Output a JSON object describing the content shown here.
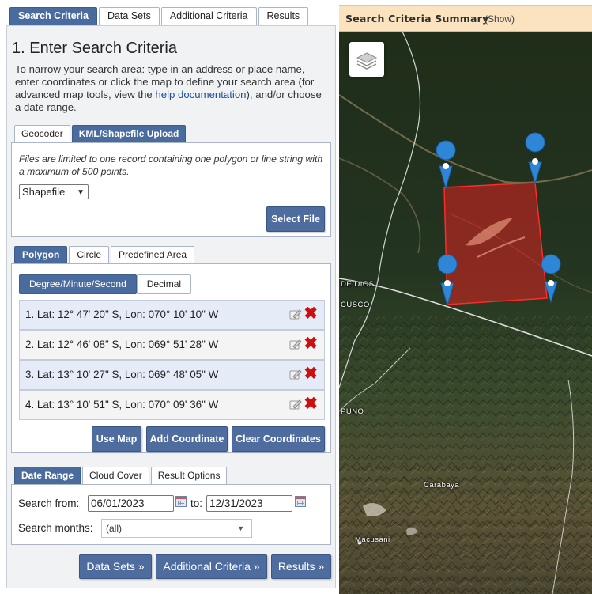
{
  "main_tabs": [
    {
      "label": "Search Criteria",
      "active": true
    },
    {
      "label": "Data Sets",
      "active": false
    },
    {
      "label": "Additional Criteria",
      "active": false
    },
    {
      "label": "Results",
      "active": false
    }
  ],
  "search": {
    "title": "1. Enter Search Criteria",
    "intro_before_link": "To narrow your search area: type in an address or place name, enter coordinates or click the map to define your search area (for advanced map tools, view the ",
    "help_link": "help documentation",
    "intro_after_link": "), and/or choose a date range."
  },
  "upload": {
    "tabs": [
      {
        "label": "Geocoder",
        "active": false
      },
      {
        "label": "KML/Shapefile Upload",
        "active": true
      }
    ],
    "note": "Files are limited to one record containing one polygon or line string with a maximum of 500 points.",
    "file_type": "Shapefile",
    "select_file_label": "Select File"
  },
  "area": {
    "tabs": [
      {
        "label": "Polygon",
        "active": true
      },
      {
        "label": "Circle",
        "active": false
      },
      {
        "label": "Predefined Area",
        "active": false
      }
    ],
    "format_tabs": [
      {
        "label": "Degree/Minute/Second",
        "active": true
      },
      {
        "label": "Decimal",
        "active": false
      }
    ],
    "coordinates": [
      "1.  Lat: 12° 47' 20\" S, Lon: 070° 10' 10\" W",
      "2.  Lat: 12° 46' 08\" S, Lon: 069° 51' 28\" W",
      "3.  Lat: 13° 10' 27\" S, Lon: 069° 48' 05\" W",
      "4.  Lat: 13° 10' 51\" S, Lon: 070° 09' 36\" W"
    ],
    "use_map_label": "Use Map",
    "add_coordinate_label": "Add Coordinate",
    "clear_coordinates_label": "Clear Coordinates"
  },
  "date": {
    "tabs": [
      {
        "label": "Date Range",
        "active": true
      },
      {
        "label": "Cloud Cover",
        "active": false
      },
      {
        "label": "Result Options",
        "active": false
      }
    ],
    "search_from_label": "Search from:",
    "from_value": "06/01/2023",
    "to_label": "to:",
    "to_value": "12/31/2023",
    "months_label": "Search months:",
    "months_value": "(all)"
  },
  "nav": {
    "datasets_label": "Data Sets »",
    "additional_label": "Additional Criteria »",
    "results_label": "Results »"
  },
  "summary": {
    "title": "Search Criteria Summary",
    "show_label": "(Show)"
  },
  "map": {
    "labels": {
      "de_dios": "DE DIOS",
      "cusco": "CUSCO",
      "puno": "PUNO",
      "carabaya": "Carabaya",
      "macusani": "Macusani"
    },
    "polygon_color": "#e02020",
    "marker_color": "#2f86d6"
  }
}
